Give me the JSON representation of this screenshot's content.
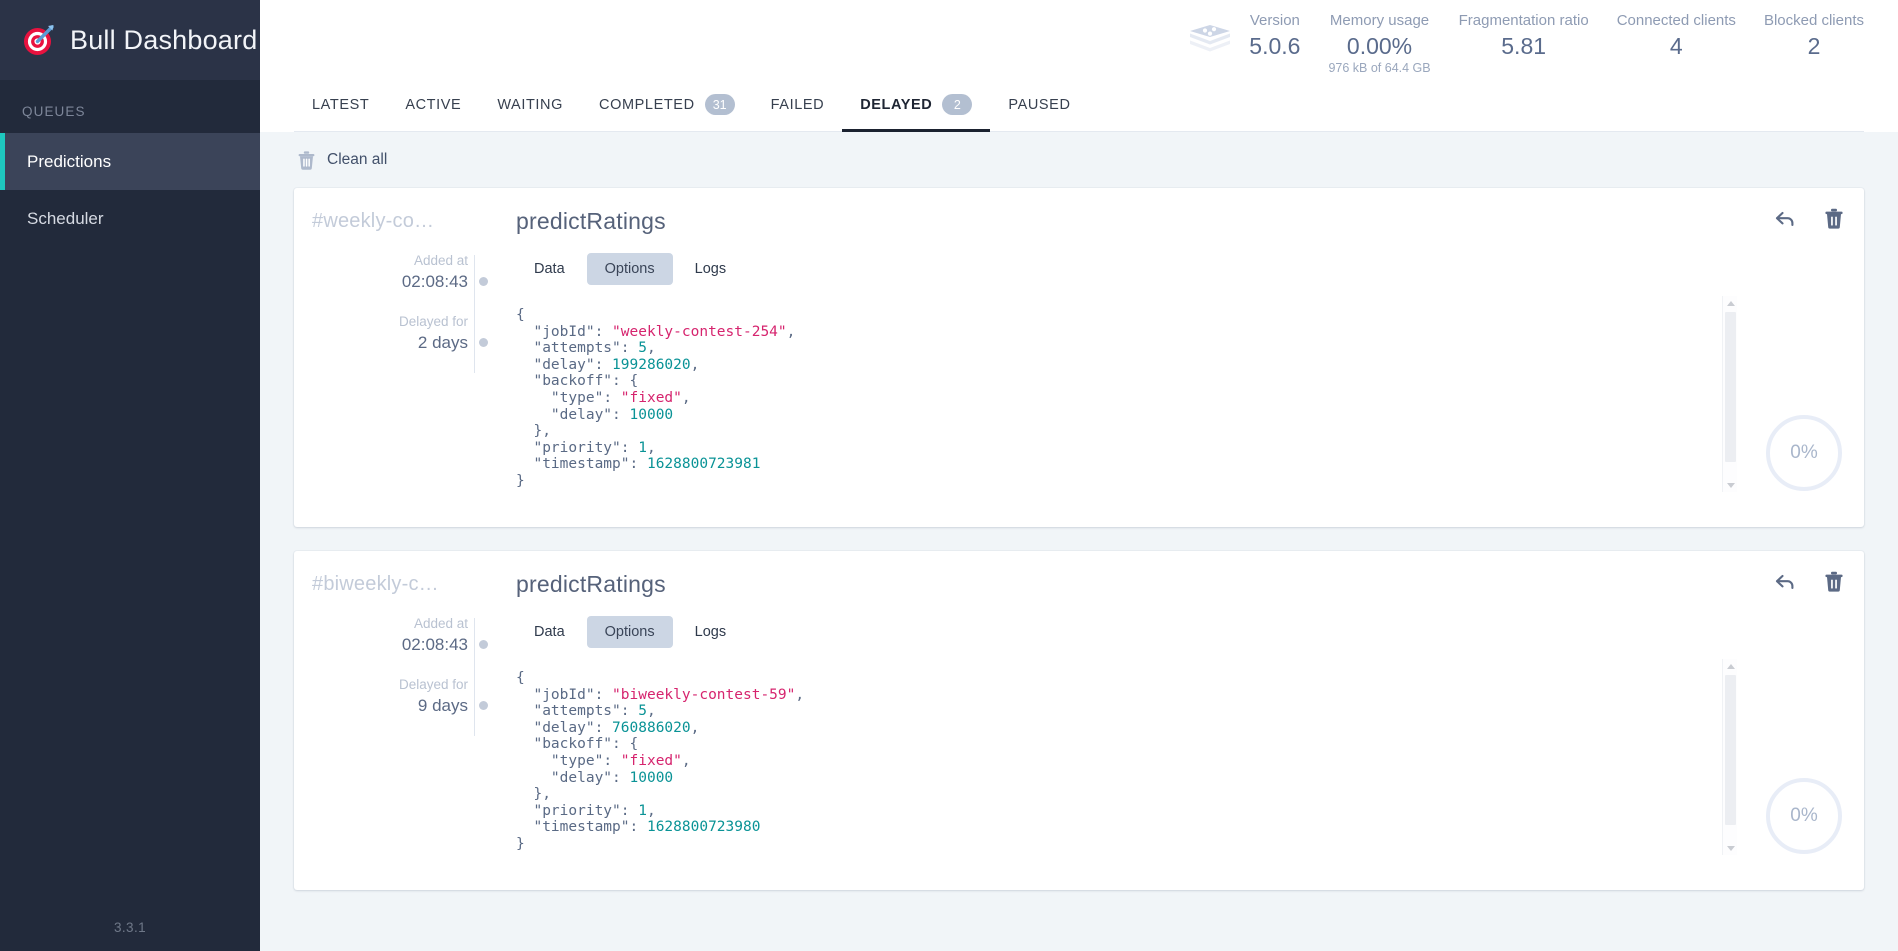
{
  "brand": {
    "title": "Bull Dashboard",
    "logo_icon": "target-dart-icon"
  },
  "sidebar": {
    "section_label": "QUEUES",
    "items": [
      {
        "label": "Predictions",
        "active": true
      },
      {
        "label": "Scheduler",
        "active": false
      }
    ],
    "version": "3.3.1"
  },
  "topbar": {
    "redis_icon": "redis-stack-icon",
    "stats": [
      {
        "label": "Version",
        "value": "5.0.6",
        "sub": ""
      },
      {
        "label": "Memory usage",
        "value": "0.00%",
        "sub": "976 kB of 64.4 GB"
      },
      {
        "label": "Fragmentation ratio",
        "value": "5.81",
        "sub": ""
      },
      {
        "label": "Connected clients",
        "value": "4",
        "sub": ""
      },
      {
        "label": "Blocked clients",
        "value": "2",
        "sub": ""
      }
    ]
  },
  "tabs": [
    {
      "label": "LATEST",
      "badge": "",
      "active": false
    },
    {
      "label": "ACTIVE",
      "badge": "",
      "active": false
    },
    {
      "label": "WAITING",
      "badge": "",
      "active": false
    },
    {
      "label": "COMPLETED",
      "badge": "31",
      "active": false
    },
    {
      "label": "FAILED",
      "badge": "",
      "active": false
    },
    {
      "label": "DELAYED",
      "badge": "2",
      "active": true
    },
    {
      "label": "PAUSED",
      "badge": "",
      "active": false
    }
  ],
  "toolbar": {
    "clean_all_label": "Clean all",
    "clean_all_icon": "trash-icon"
  },
  "jobs": [
    {
      "job_id": "#weekly-co…",
      "name": "predictRatings",
      "added_at_label": "Added at",
      "added_at_value": "02:08:43",
      "delayed_for_label": "Delayed for",
      "delayed_for_value": "2 days",
      "segments": [
        {
          "label": "Data",
          "active": false
        },
        {
          "label": "Options",
          "active": true
        },
        {
          "label": "Logs",
          "active": false
        }
      ],
      "progress": "0%",
      "actions": [
        {
          "icon": "retry-arrow-icon"
        },
        {
          "icon": "trash-icon"
        }
      ],
      "options": {
        "jobId": "weekly-contest-254",
        "attempts": 5,
        "delay": 199286020,
        "backoff": {
          "type": "fixed",
          "delay": 10000
        },
        "priority": 1,
        "timestamp": 1628800723981
      }
    },
    {
      "job_id": "#biweekly-c…",
      "name": "predictRatings",
      "added_at_label": "Added at",
      "added_at_value": "02:08:43",
      "delayed_for_label": "Delayed for",
      "delayed_for_value": "9 days",
      "segments": [
        {
          "label": "Data",
          "active": false
        },
        {
          "label": "Options",
          "active": true
        },
        {
          "label": "Logs",
          "active": false
        }
      ],
      "progress": "0%",
      "actions": [
        {
          "icon": "retry-arrow-icon"
        },
        {
          "icon": "trash-icon"
        }
      ],
      "options": {
        "jobId": "biweekly-contest-59",
        "attempts": 5,
        "delay": 760886020,
        "backoff": {
          "type": "fixed",
          "delay": 10000
        },
        "priority": 1,
        "timestamp": 1628800723980
      }
    }
  ],
  "colors": {
    "sidebar_bg": "#222a3b",
    "accent_teal": "#1ec8bf",
    "page_bg": "#f1f5f8",
    "json_string": "#d6246e",
    "json_number": "#0a9396",
    "json_key": "#5a6a85"
  }
}
